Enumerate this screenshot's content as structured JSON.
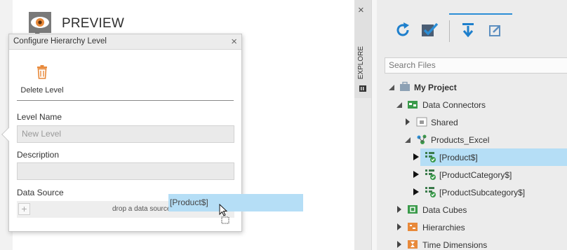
{
  "canvas": {
    "preview_label": "PREVIEW"
  },
  "dialog": {
    "title": "Configure Hierarchy Level",
    "close_glyph": "×",
    "delete_level_label": "Delete Level",
    "level_name_label": "Level Name",
    "level_name_value": "New Level",
    "description_label": "Description",
    "description_value": "",
    "data_source_label": "Data Source",
    "data_source_add_glyph": "+",
    "data_source_drop_text": "drop a data source"
  },
  "drag": {
    "label": "[Product$]"
  },
  "explore_tab": {
    "close_glyph": "×",
    "label": "EXPLORE"
  },
  "toolbar": {
    "tools": [
      "refresh-icon",
      "check-icon",
      "filter-down-icon",
      "edit-icon"
    ],
    "accent_color": "#2b8ed6"
  },
  "search": {
    "placeholder": "Search Files"
  },
  "tree": {
    "project": "My Project",
    "data_connectors": "Data Connectors",
    "shared": "Shared",
    "products_excel": "Products_Excel",
    "product": "[Product$]",
    "product_category": "[ProductCategory$]",
    "product_subcategory": "[ProductSubcategory$]",
    "data_cubes": "Data Cubes",
    "hierarchies": "Hierarchies",
    "time_dimensions": "Time Dimensions"
  },
  "colors": {
    "selection": "#b5def6",
    "folder_orange": "#e8893a",
    "connector_green": "#3a9a4a"
  }
}
